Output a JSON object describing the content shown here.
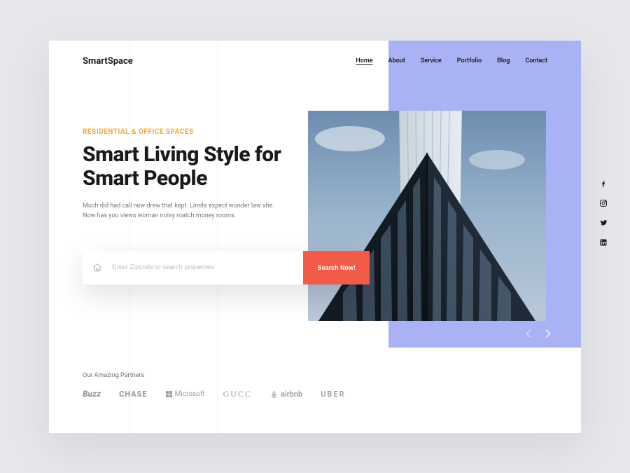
{
  "brand": "SmartSpace",
  "nav": {
    "items": [
      {
        "label": "Home",
        "active": true
      },
      {
        "label": "About",
        "active": false
      },
      {
        "label": "Service",
        "active": false
      },
      {
        "label": "Portfolio",
        "active": false
      },
      {
        "label": "Blog",
        "active": false
      },
      {
        "label": "Contact",
        "active": false
      }
    ]
  },
  "hero": {
    "eyebrow": "RESIDENTIAL & OFFICE SPACES",
    "headline": "Smart Living Style for Smart People",
    "subcopy": "Much did had call new drew that kept. Limits expect wonder law she. Now has you views woman noisy match money rooms."
  },
  "search": {
    "placeholder": "Enter Zipcode to search properties",
    "button": "Search Now!"
  },
  "partners": {
    "title": "Our Amazing Partners",
    "items": [
      "Buzz",
      "CHASE",
      "Microsoft",
      "GUCC",
      "airbnb",
      "UBER"
    ]
  },
  "social": [
    "facebook",
    "instagram",
    "twitter",
    "linkedin"
  ],
  "colors": {
    "accent_panel": "#a9b2f5",
    "eyebrow": "#f2a93b",
    "cta": "#f15b47"
  }
}
